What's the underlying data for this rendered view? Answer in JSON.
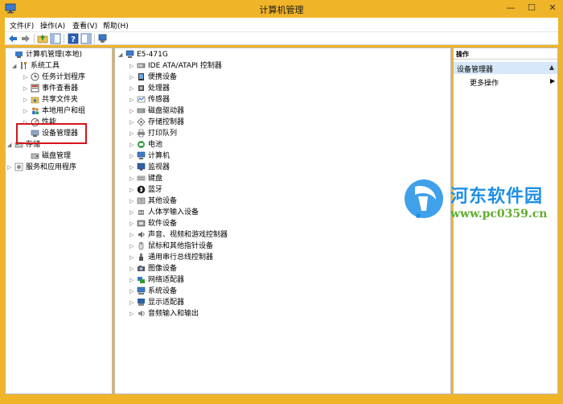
{
  "window": {
    "title": "计算机管理"
  },
  "menu": [
    "文件(F)",
    "操作(A)",
    "查看(V)",
    "帮助(H)"
  ],
  "left_tree": [
    {
      "label": "计算机管理(本地)",
      "icon": "computer-management-icon",
      "expander": ""
    },
    {
      "label": "系统工具",
      "icon": "tools-icon",
      "expander": "◢"
    },
    {
      "label": "任务计划程序",
      "icon": "clock-icon",
      "expander": "▷"
    },
    {
      "label": "事件查看器",
      "icon": "event-viewer-icon",
      "expander": "▷"
    },
    {
      "label": "共享文件夹",
      "icon": "shared-folder-icon",
      "expander": "▷"
    },
    {
      "label": "本地用户和组",
      "icon": "users-icon",
      "expander": "▷"
    },
    {
      "label": "性能",
      "icon": "performance-icon",
      "expander": "▷"
    },
    {
      "label": "设备管理器",
      "icon": "device-manager-icon",
      "expander": ""
    },
    {
      "label": "存储",
      "icon": "storage-icon",
      "expander": "◢"
    },
    {
      "label": "磁盘管理",
      "icon": "disk-icon",
      "expander": ""
    },
    {
      "label": "服务和应用程序",
      "icon": "services-icon",
      "expander": "▷"
    }
  ],
  "device_tree": {
    "root": "E5-471G",
    "items": [
      {
        "label": "IDE ATA/ATAPI 控制器",
        "icon": "ide-controller-icon"
      },
      {
        "label": "便携设备",
        "icon": "portable-device-icon"
      },
      {
        "label": "处理器",
        "icon": "processor-icon"
      },
      {
        "label": "传感器",
        "icon": "sensor-icon"
      },
      {
        "label": "磁盘驱动器",
        "icon": "disk-drive-icon"
      },
      {
        "label": "存储控制器",
        "icon": "storage-controller-icon"
      },
      {
        "label": "打印队列",
        "icon": "printer-icon"
      },
      {
        "label": "电池",
        "icon": "battery-icon"
      },
      {
        "label": "计算机",
        "icon": "computer-icon"
      },
      {
        "label": "监视器",
        "icon": "monitor-icon"
      },
      {
        "label": "键盘",
        "icon": "keyboard-icon"
      },
      {
        "label": "蓝牙",
        "icon": "bluetooth-icon"
      },
      {
        "label": "其他设备",
        "icon": "other-device-icon"
      },
      {
        "label": "人体学输入设备",
        "icon": "hid-icon"
      },
      {
        "label": "软件设备",
        "icon": "software-device-icon"
      },
      {
        "label": "声音、视频和游戏控制器",
        "icon": "sound-icon"
      },
      {
        "label": "鼠标和其他指针设备",
        "icon": "mouse-icon"
      },
      {
        "label": "通用串行总线控制器",
        "icon": "usb-icon"
      },
      {
        "label": "图像设备",
        "icon": "imaging-icon"
      },
      {
        "label": "网络适配器",
        "icon": "network-adapter-icon"
      },
      {
        "label": "系统设备",
        "icon": "system-device-icon"
      },
      {
        "label": "显示适配器",
        "icon": "display-adapter-icon"
      },
      {
        "label": "音频输入和输出",
        "icon": "audio-io-icon"
      }
    ]
  },
  "actions": {
    "header": "操作",
    "section": "设备管理器",
    "more": "更多操作"
  },
  "watermark": {
    "text": "河东软件园",
    "url": "www.pc0359.cn"
  },
  "colors": {
    "frame": "#f0b428",
    "highlight": "#d2161b",
    "selection": "#d6e8fa",
    "watermark_blue": "#1e8fe6",
    "watermark_green": "#5fae2d"
  }
}
